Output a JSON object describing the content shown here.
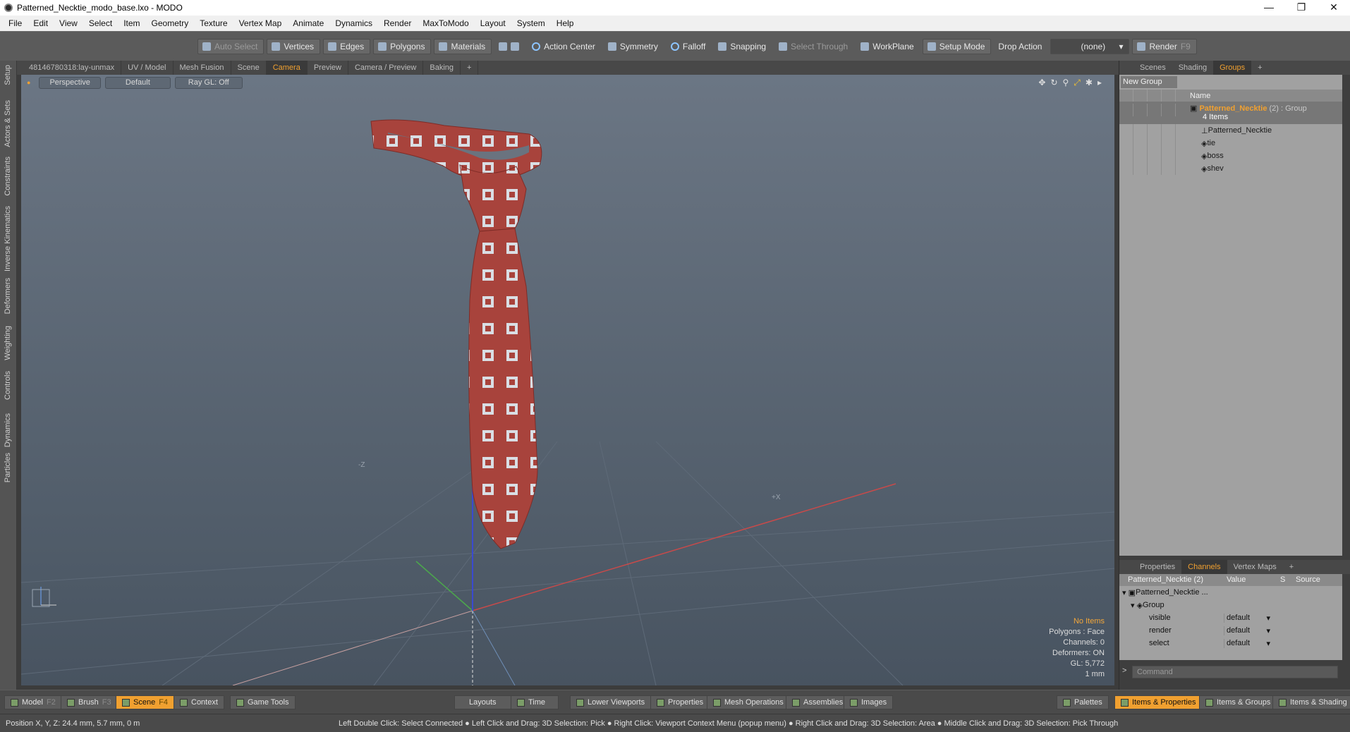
{
  "window": {
    "title": "Patterned_Necktie_modo_base.lxo - MODO",
    "controls": [
      "—",
      "❐",
      "✕"
    ]
  },
  "menu": [
    "File",
    "Edit",
    "View",
    "Select",
    "Item",
    "Geometry",
    "Texture",
    "Vertex Map",
    "Animate",
    "Dynamics",
    "Render",
    "MaxToModo",
    "Layout",
    "System",
    "Help"
  ],
  "toolbar": {
    "auto_select": "Auto Select",
    "vertices": "Vertices",
    "edges": "Edges",
    "polygons": "Polygons",
    "materials": "Materials",
    "action_center": "Action Center",
    "symmetry": "Symmetry",
    "falloff": "Falloff",
    "snapping": "Snapping",
    "select_through": "Select Through",
    "workplane": "WorkPlane",
    "setup_mode": "Setup Mode",
    "drop_action": "Drop Action",
    "drop_value": "(none)",
    "render": "Render",
    "render_key": "F9"
  },
  "left_strip": [
    "Setup",
    "Actors & Sets",
    "Constraints",
    "Inverse Kinematics",
    "Deformers",
    "Weighting",
    "Controls",
    "Dynamics",
    "Particles"
  ],
  "viewport_tabs": [
    "48146780318:lay-unmax",
    "UV / Model",
    "Mesh Fusion",
    "Scene",
    "Camera",
    "Preview",
    "Camera / Preview",
    "Baking",
    "+"
  ],
  "viewport": {
    "view": "Perspective",
    "shading": "Default",
    "raygl": "Ray GL: Off",
    "axis_z": "-Z",
    "axis_x": "+X",
    "info": {
      "items": "No Items",
      "polygons": "Polygons : Face",
      "channels": "Channels: 0",
      "deformers": "Deformers: ON",
      "gl": "GL: 5,772",
      "unit": "1 mm"
    }
  },
  "right_tabs": [
    "Scenes",
    "Shading",
    "Groups",
    "+"
  ],
  "groups": {
    "new_group": "New Group",
    "name_header": "Name",
    "group_name": "Patterned_Necktie",
    "group_suffix": "(2) : Group",
    "group_count": "4 Items",
    "items": [
      "Patterned_Necktie",
      "tie",
      "boss",
      "shev"
    ]
  },
  "channel_tabs": [
    "Properties",
    "Channels",
    "Vertex Maps",
    "+"
  ],
  "channels": {
    "header_name": "Patterned_Necktie (2)",
    "header_value": "Value",
    "header_s": "S",
    "header_source": "Source",
    "root": "Patterned_Necktie ...",
    "group": "Group",
    "rows": [
      {
        "name": "visible",
        "value": "default"
      },
      {
        "name": "render",
        "value": "default"
      },
      {
        "name": "select",
        "value": "default"
      }
    ],
    "command_placeholder": "Command"
  },
  "bottom_bar": {
    "model": "Model",
    "model_key": "F2",
    "brush": "Brush",
    "brush_key": "F3",
    "scene": "Scene",
    "scene_key": "F4",
    "context": "Context",
    "game_tools": "Game Tools",
    "layouts": "Layouts",
    "time": "Time",
    "lower_viewports": "Lower Viewports",
    "properties": "Properties",
    "mesh_operations": "Mesh Operations",
    "assemblies": "Assemblies",
    "images": "Images",
    "palettes": "Palettes",
    "items_properties": "Items & Properties",
    "items_groups": "Items & Groups",
    "items_shading": "Items & Shading"
  },
  "status": {
    "position": "Position X, Y, Z:   24.4 mm, 5.7 mm, 0 m",
    "hint": "Left Double Click: Select Connected ● Left Click and Drag: 3D Selection: Pick ● Right Click: Viewport Context Menu (popup menu) ● Right Click and Drag: 3D Selection: Area ● Middle Click and Drag: 3D Selection: Pick Through"
  },
  "colors": {
    "accent": "#f0a030",
    "tie_red": "#a8433c",
    "pattern": "#c9cfd6",
    "viewport_bg": "#5a6572"
  }
}
